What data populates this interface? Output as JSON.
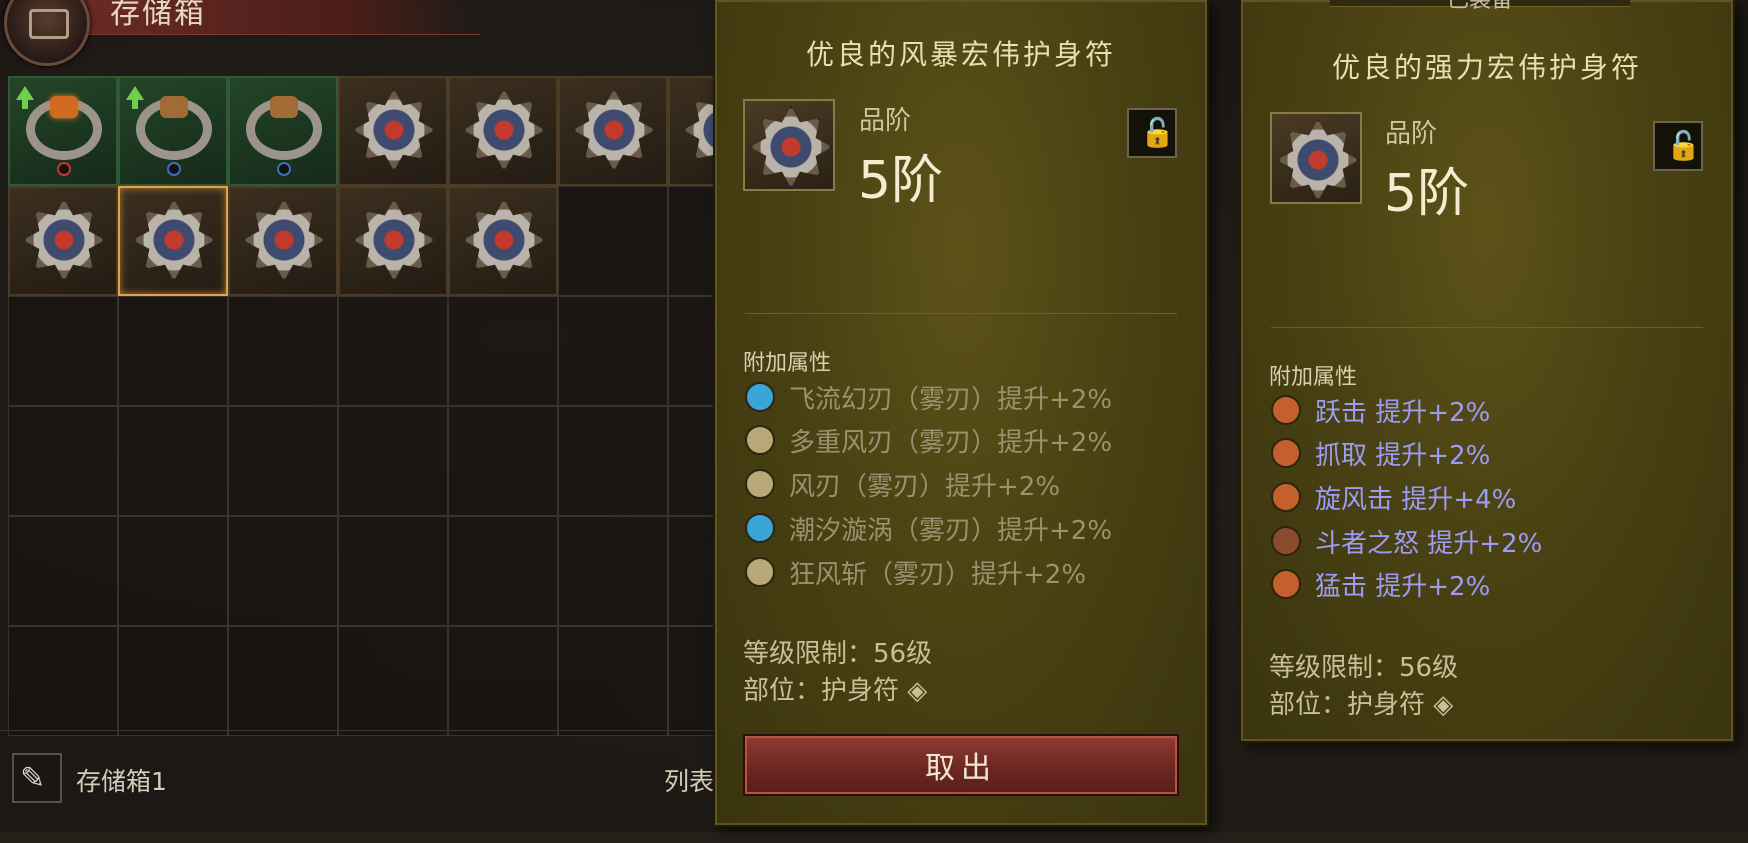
{
  "storage": {
    "title": "存储箱",
    "footer_label": "存储箱1",
    "footer_list_label": "列表"
  },
  "grid": {
    "row1": [
      {
        "type": "ring",
        "gem": "orange",
        "upgrade": true,
        "socket": "red"
      },
      {
        "type": "ring",
        "gem": "bronze",
        "upgrade": true,
        "socket": "blue"
      },
      {
        "type": "ring",
        "gem": "bronze",
        "upgrade": false,
        "socket": "blue"
      },
      {
        "type": "amulet"
      },
      {
        "type": "amulet"
      },
      {
        "type": "amulet"
      },
      {
        "type": "amulet"
      }
    ],
    "row2": [
      {
        "type": "amulet"
      },
      {
        "type": "amulet",
        "selected": true
      },
      {
        "type": "amulet"
      },
      {
        "type": "amulet"
      },
      {
        "type": "amulet"
      }
    ]
  },
  "tooltip_left": {
    "name": "优良的风暴宏伟护身符",
    "rank_label": "品阶",
    "rank_value": "5阶",
    "lock_icon": "unlock-icon",
    "affix_title": "附加属性",
    "affixes": [
      {
        "text": "飞流幻刃（雾刃）提升+2%",
        "icon_color": "#3aa6d8"
      },
      {
        "text": "多重风刃（雾刃）提升+2%",
        "icon_color": "#b8a878"
      },
      {
        "text": "风刃（雾刃）提升+2%",
        "icon_color": "#b8a878"
      },
      {
        "text": "潮汐漩涡（雾刃）提升+2%",
        "icon_color": "#3aa6d8"
      },
      {
        "text": "狂风斩（雾刃）提升+2%",
        "icon_color": "#b8a878"
      }
    ],
    "level_req": "等级限制：56级",
    "slot": "部位：护身符",
    "take_button": "取出"
  },
  "tooltip_right": {
    "equipped_tag": "已装备",
    "name": "优良的强力宏伟护身符",
    "rank_label": "品阶",
    "rank_value": "5阶",
    "lock_icon": "unlock-icon",
    "affix_title": "附加属性",
    "affixes": [
      {
        "text": "跃击  提升+2%",
        "icon_color": "#c4602c"
      },
      {
        "text": "抓取  提升+2%",
        "icon_color": "#c4602c"
      },
      {
        "text": "旋风击  提升+4%",
        "icon_color": "#c4602c"
      },
      {
        "text": "斗者之怒  提升+2%",
        "icon_color": "#8a4a2c"
      },
      {
        "text": "猛击  提升+2%",
        "icon_color": "#c4602c"
      }
    ],
    "level_req": "等级限制：56级",
    "slot": "部位：护身符"
  },
  "colors": {
    "panel_bg": "#4a4213",
    "affix_dim": "#9a9170",
    "affix_blue": "#9d9cf4",
    "take_button": "#8e3a30"
  }
}
